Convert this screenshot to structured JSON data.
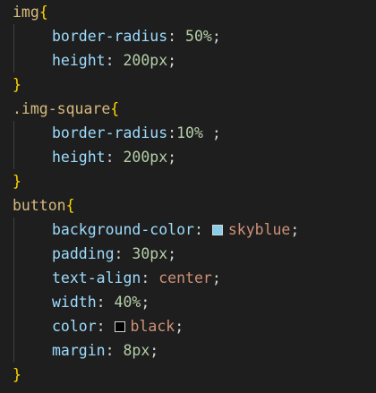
{
  "code_lines": [
    {
      "sel": "img",
      "brace": "{"
    },
    {
      "prop": "border-radius",
      "colon": ": ",
      "value": "50%",
      "end": ";"
    },
    {
      "prop": "height",
      "colon": ": ",
      "value": "200px",
      "end": ";"
    },
    {
      "brace": "}"
    },
    {
      "sel": ".img-square",
      "brace": "{"
    },
    {
      "prop": "border-radius",
      "colon": ":",
      "value": "10%",
      "end": " ;"
    },
    {
      "prop": "height",
      "colon": ": ",
      "value": "200px",
      "end": ";"
    },
    {
      "brace": "}"
    },
    {
      "sel": "button",
      "brace": "{"
    },
    {
      "prop": "background-color",
      "colon": ": ",
      "value": "skyblue",
      "end": ";",
      "swatch": "#87ceeb"
    },
    {
      "prop": "padding",
      "colon": ": ",
      "value": "30px",
      "end": ";"
    },
    {
      "prop": "text-align",
      "colon": ": ",
      "value": "center",
      "end": ";"
    },
    {
      "prop": "width",
      "colon": ": ",
      "value": "40%",
      "end": ";"
    },
    {
      "prop": "color",
      "colon": ": ",
      "value": "black",
      "end": ";",
      "swatch": "#000000"
    },
    {
      "prop": "margin",
      "colon": ": ",
      "value": "8px",
      "end": ";"
    },
    {
      "brace": "}"
    }
  ]
}
